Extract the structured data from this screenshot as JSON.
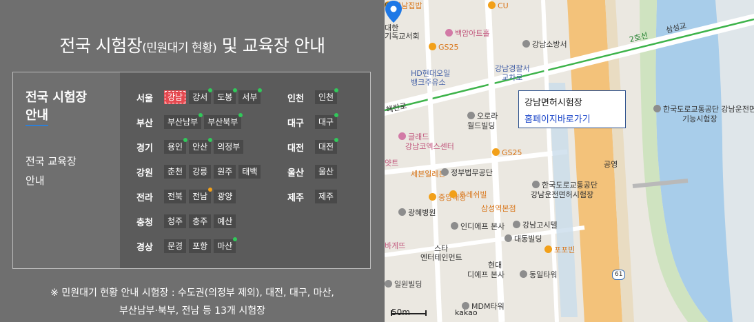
{
  "title": {
    "main": "전국 시험장",
    "sub": "(민원대기 현황)",
    "tail": " 및 교육장 안내"
  },
  "nav": {
    "item1": "전국 시험장 안내",
    "item1_line1": "전국 시험장",
    "item1_line2": "안내",
    "item2_line1": "전국 교육장",
    "item2_line2": "안내"
  },
  "regions_left": [
    {
      "name": "서울",
      "tags": [
        {
          "label": "강남",
          "active": true,
          "dot": ""
        },
        {
          "label": "강서",
          "dot": "green"
        },
        {
          "label": "도봉",
          "dot": "green"
        },
        {
          "label": "서부",
          "dot": "green"
        }
      ]
    },
    {
      "name": "부산",
      "tags": [
        {
          "label": "부산남부",
          "dot": "green"
        },
        {
          "label": "부산북부",
          "dot": "green"
        }
      ]
    },
    {
      "name": "경기",
      "tags": [
        {
          "label": "용인",
          "dot": "green"
        },
        {
          "label": "안산",
          "dot": "green"
        },
        {
          "label": "의정부",
          "dot": ""
        }
      ]
    },
    {
      "name": "강원",
      "tags": [
        {
          "label": "춘천",
          "dot": ""
        },
        {
          "label": "강릉",
          "dot": ""
        },
        {
          "label": "원주",
          "dot": ""
        },
        {
          "label": "태백",
          "dot": ""
        }
      ]
    },
    {
      "name": "전라",
      "tags": [
        {
          "label": "전북",
          "dot": ""
        },
        {
          "label": "전남",
          "dot": "orange"
        },
        {
          "label": "광양",
          "dot": ""
        }
      ]
    },
    {
      "name": "충청",
      "tags": [
        {
          "label": "청주",
          "dot": ""
        },
        {
          "label": "충주",
          "dot": ""
        },
        {
          "label": "예산",
          "dot": ""
        }
      ]
    },
    {
      "name": "경상",
      "tags": [
        {
          "label": "문경",
          "dot": ""
        },
        {
          "label": "포항",
          "dot": ""
        },
        {
          "label": "마산",
          "dot": "green"
        }
      ]
    }
  ],
  "regions_right": [
    {
      "name": "인천",
      "tags": [
        {
          "label": "인천",
          "dot": "green"
        }
      ]
    },
    {
      "name": "대구",
      "tags": [
        {
          "label": "대구",
          "dot": "green"
        }
      ]
    },
    {
      "name": "대전",
      "tags": [
        {
          "label": "대전",
          "dot": "green"
        }
      ]
    },
    {
      "name": "울산",
      "tags": [
        {
          "label": "울산",
          "dot": ""
        }
      ]
    },
    {
      "name": "제주",
      "tags": [
        {
          "label": "제주",
          "dot": ""
        }
      ]
    }
  ],
  "note": {
    "line1": "※ 민원대기 현황 안내 시험장 : 수도권(의정부 제외), 대전, 대구, 마산,",
    "line2": "부산남부·북부, 전남 등 13개 시험장"
  },
  "map": {
    "popup_title": "강남면허시험장",
    "popup_link": "홈페이지바로가기",
    "scale": "50m",
    "brand": "kakao",
    "road_labels": {
      "line2": "2호선",
      "samseong": "삼성교",
      "bridge_left": "헤란로",
      "route": "61"
    },
    "labels": [
      {
        "t": "강남집밥",
        "c": "orange",
        "i": "o"
      },
      {
        "t": "CU",
        "c": "orange",
        "i": "o"
      },
      {
        "t": "대한",
        "c": "",
        "i": ""
      },
      {
        "t": "기독교서회",
        "c": "",
        "i": ""
      },
      {
        "t": "백암아트홀",
        "c": "pink",
        "i": "p"
      },
      {
        "t": "GS25",
        "c": "orange",
        "i": "o"
      },
      {
        "t": "강남소방서",
        "c": "",
        "i": "g"
      },
      {
        "t": "HD현대오일",
        "c": "blue",
        "i": ""
      },
      {
        "t": "뱅크주유소",
        "c": "blue",
        "i": ""
      },
      {
        "t": "강남경찰서",
        "c": "blue",
        "i": ""
      },
      {
        "t": "교차로",
        "c": "blue",
        "i": ""
      },
      {
        "t": "오로라",
        "c": "",
        "i": "g"
      },
      {
        "t": "월드빌딩",
        "c": "",
        "i": ""
      },
      {
        "t": "글래드",
        "c": "pink",
        "i": "p"
      },
      {
        "t": "강남코엑스센터",
        "c": "pink",
        "i": ""
      },
      {
        "t": "GS25",
        "c": "orange",
        "i": "o"
      },
      {
        "t": "얏트",
        "c": "pink",
        "i": ""
      },
      {
        "t": "세븐일레븐",
        "c": "orange",
        "i": ""
      },
      {
        "t": "정부법무공단",
        "c": "",
        "i": "g"
      },
      {
        "t": "중앙해장",
        "c": "orange",
        "i": "o"
      },
      {
        "t": "후레쉬빌",
        "c": "orange",
        "i": "o"
      },
      {
        "t": "삼성역본점",
        "c": "orange",
        "i": ""
      },
      {
        "t": "광혜병원",
        "c": "",
        "i": "g"
      },
      {
        "t": "인디에프 본사",
        "c": "",
        "i": "g"
      },
      {
        "t": "바게뜨",
        "c": "pink",
        "i": ""
      },
      {
        "t": "스타",
        "c": "",
        "i": ""
      },
      {
        "t": "엔터테인먼트",
        "c": "",
        "i": ""
      },
      {
        "t": "대동빌딩",
        "c": "",
        "i": "g"
      },
      {
        "t": "강남고시텔",
        "c": "",
        "i": "g"
      },
      {
        "t": "포포빈",
        "c": "orange",
        "i": "o"
      },
      {
        "t": "현대",
        "c": "",
        "i": ""
      },
      {
        "t": "디에프 본사",
        "c": "",
        "i": ""
      },
      {
        "t": "동일타워",
        "c": "",
        "i": "g"
      },
      {
        "t": "일원빌딩",
        "c": "",
        "i": "g"
      },
      {
        "t": "MDM타워",
        "c": "",
        "i": "g"
      },
      {
        "t": "한국도로교통공단",
        "c": "",
        "i": "g"
      },
      {
        "t": "강남운전면허시험장",
        "c": "",
        "i": ""
      },
      {
        "t": "공영",
        "c": "",
        "i": ""
      },
      {
        "t": "한국도로교통공단 강남운전면허",
        "c": "",
        "i": "g"
      },
      {
        "t": "기능시험장",
        "c": "",
        "i": ""
      },
      {
        "t": "딩",
        "c": "",
        "i": ""
      }
    ]
  }
}
